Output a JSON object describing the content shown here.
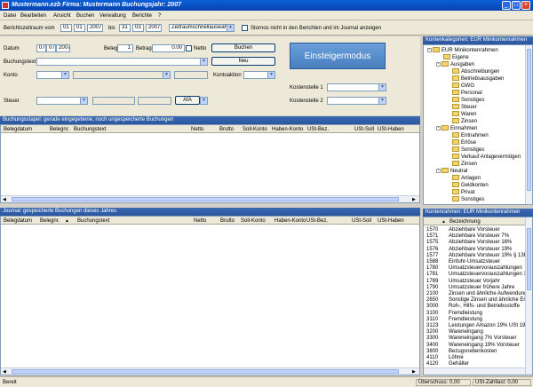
{
  "window": {
    "title": "Mustermann.ezb  Firma: Mustermann  Buchungsjahr: 2007"
  },
  "menu": [
    "Datei",
    "Bearbeiten",
    "Ansicht",
    "Buchen",
    "Verwaltung",
    "Berichte",
    "?"
  ],
  "toolbar": {
    "range_label": "Berichtszeitraum vom",
    "from_day": "01",
    "from_month": "01",
    "from_year": "2007",
    "bis_label": "bis",
    "to_day": "31",
    "to_month": "03",
    "to_year": "2007",
    "quick_select": "Zeitraumschnellauswahl",
    "storno_label": "Stornos nicht in den Berichten und im Journal anzeigen"
  },
  "form": {
    "datum_label": "Datum",
    "datum_day": "07",
    "datum_month": "07",
    "datum_year": "2007",
    "beleg_label": "Beleg",
    "beleg_value": "1",
    "betrag_label": "Betrag",
    "betrag_value": "0.00",
    "netto_label": "Netto",
    "buchen_button": "Buchen",
    "neu_button": "Neu",
    "buchungstext_label": "Buchungstext",
    "konto_label": "Konto",
    "kontoaktion_label": "Kontoaktion",
    "steuer_label": "Steuer",
    "afa_label": "AfA",
    "kostenstelle1_label": "Kostenstelle 1",
    "kostenstelle2_label": "Kostenstelle 2",
    "einsteiger_button": "Einsteigermodus"
  },
  "stapel": {
    "header": "Buchungsstapel: gerade eingegebene, noch ungespeicherte Buchungen",
    "columns": [
      "Belegdatum",
      "Belegnr.",
      "Buchungstext",
      "Netto",
      "Brutto",
      "Soll-Konto",
      "Haben-Konto",
      "USt-Bez.",
      "USt-Soll",
      "USt-Haben"
    ]
  },
  "journal": {
    "header": "Journal: gespeicherte Buchungen dieses Jahres",
    "columns": [
      "Belegdatum",
      "Belegnr.",
      "Buchungstext",
      "Netto",
      "Brutto",
      "Soll-Konto",
      "Haben-Konto",
      "USt-Bez.",
      "USt-Soll",
      "USt-Haben"
    ]
  },
  "kategorien": {
    "header": "Kontenkategorien: EUR Minikontenrahmen",
    "tree": [
      {
        "label": "EUR Minikontenrahmen",
        "level": 0,
        "exp": "-"
      },
      {
        "label": "Eigene",
        "level": 1,
        "exp": ""
      },
      {
        "label": "Ausgaben",
        "level": 1,
        "exp": "-"
      },
      {
        "label": "Abschreibungen",
        "level": 2,
        "exp": ""
      },
      {
        "label": "Betriebsausgaben",
        "level": 2,
        "exp": ""
      },
      {
        "label": "GWG",
        "level": 2,
        "exp": ""
      },
      {
        "label": "Personal",
        "level": 2,
        "exp": ""
      },
      {
        "label": "Sonstiges",
        "level": 2,
        "exp": ""
      },
      {
        "label": "Steuer",
        "level": 2,
        "exp": ""
      },
      {
        "label": "Waren",
        "level": 2,
        "exp": ""
      },
      {
        "label": "Zinsen",
        "level": 2,
        "exp": ""
      },
      {
        "label": "Einnahmen",
        "level": 1,
        "exp": "-"
      },
      {
        "label": "Entnahmen",
        "level": 2,
        "exp": ""
      },
      {
        "label": "Erlöse",
        "level": 2,
        "exp": ""
      },
      {
        "label": "Sonstiges",
        "level": 2,
        "exp": ""
      },
      {
        "label": "Verkauf Anlagevermögen",
        "level": 2,
        "exp": ""
      },
      {
        "label": "Zinsen",
        "level": 2,
        "exp": ""
      },
      {
        "label": "Neutral",
        "level": 1,
        "exp": "-"
      },
      {
        "label": "Anlagen",
        "level": 2,
        "exp": ""
      },
      {
        "label": "Geldkonten",
        "level": 2,
        "exp": ""
      },
      {
        "label": "Privat",
        "level": 2,
        "exp": ""
      },
      {
        "label": "Sonstiges",
        "level": 2,
        "exp": ""
      }
    ]
  },
  "konten": {
    "header": "Kontenrahmen: EUR Minikontenrahmen",
    "col_nr": "",
    "col_bez": "Bezeichnung",
    "rows": [
      {
        "nr": "1570",
        "bez": "Abziehbare Vorsteuer"
      },
      {
        "nr": "1571",
        "bez": "Abziehbare Vorsteuer 7%"
      },
      {
        "nr": "1575",
        "bez": "Abziehbare Vorsteuer 16%"
      },
      {
        "nr": "1576",
        "bez": "Abziehbare Vorsteuer 19%"
      },
      {
        "nr": "1577",
        "bez": "Abziehbare Vorsteuer 19% § 13b US"
      },
      {
        "nr": "1588",
        "bez": "Einfuhr-Umsatzsteuer"
      },
      {
        "nr": "1780",
        "bez": "Umsatzsteuervorauszahlungen"
      },
      {
        "nr": "1781",
        "bez": "Umsatzsteuervorauszahlungen 1/11"
      },
      {
        "nr": "1789",
        "bez": "Umsatzsteuer Vorjahr"
      },
      {
        "nr": "1790",
        "bez": "Umsatzsteuer frühere Jahre"
      },
      {
        "nr": "2100",
        "bez": "Zinsen und ähnliche Aufwendungen"
      },
      {
        "nr": "2650",
        "bez": "Sonstige Zinsen und ähnliche Erträge"
      },
      {
        "nr": "3000",
        "bez": "Roh-, Hilfs- und Betriebsstoffe"
      },
      {
        "nr": "3100",
        "bez": "Fremdleistung"
      },
      {
        "nr": "3110",
        "bez": "Fremdleistung"
      },
      {
        "nr": "3123",
        "bez": "Leistungen Amazon 19% USt 19% V"
      },
      {
        "nr": "3200",
        "bez": "Wareneingang"
      },
      {
        "nr": "3300",
        "bez": "Wareneingang 7% Vorsteuer"
      },
      {
        "nr": "3400",
        "bez": "Wareneingang 19% Vorsteuer"
      },
      {
        "nr": "3800",
        "bez": "Bezugsnebenkosten"
      },
      {
        "nr": "4110",
        "bez": "Löhne"
      },
      {
        "nr": "4120",
        "bez": "Gehälter"
      }
    ]
  },
  "status": {
    "left": "Bereit",
    "ueberschuss": "Überschuss: 0,00",
    "ust": "USt-Zahllast: 0,00"
  }
}
